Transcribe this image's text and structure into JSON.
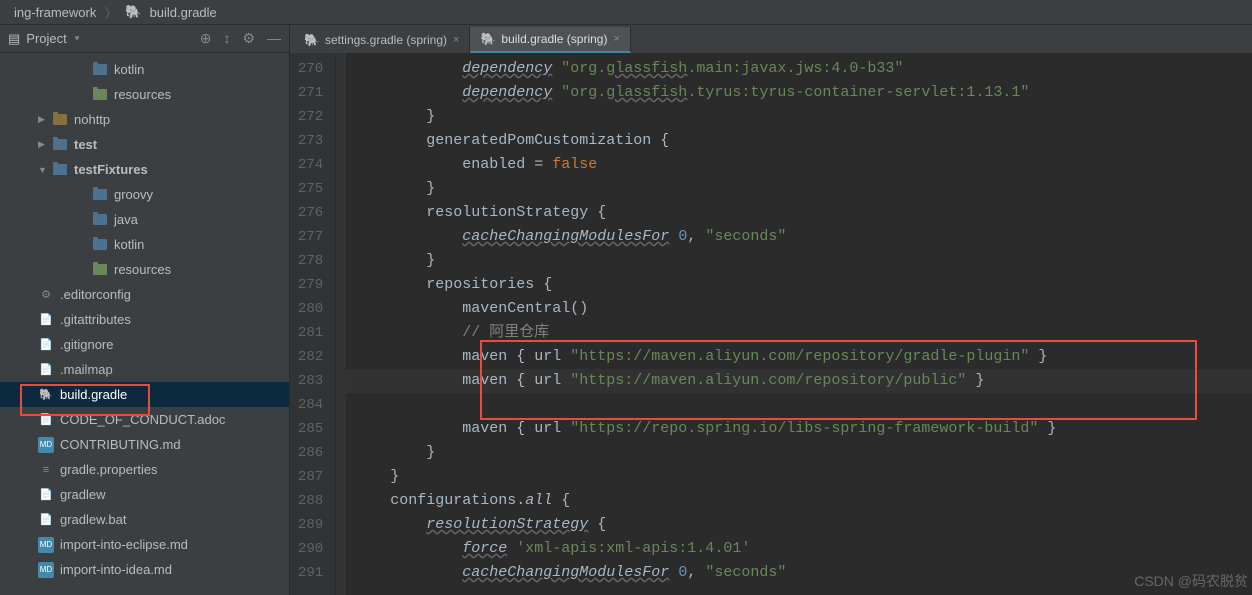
{
  "breadcrumb": {
    "root": "ing-framework",
    "file": "build.gradle"
  },
  "sidebar": {
    "title": "Project",
    "tree": [
      {
        "indent": 70,
        "type": "folder-blue",
        "label": "kotlin"
      },
      {
        "indent": 70,
        "type": "folder-res",
        "label": "resources"
      },
      {
        "indent": 30,
        "arrow": "collapsed",
        "type": "folder",
        "label": "nohttp"
      },
      {
        "indent": 30,
        "arrow": "collapsed",
        "type": "folder-blue",
        "label": "test",
        "bold": true
      },
      {
        "indent": 30,
        "arrow": "expanded",
        "type": "folder-blue",
        "label": "testFixtures",
        "bold": true
      },
      {
        "indent": 70,
        "type": "folder-blue",
        "label": "groovy"
      },
      {
        "indent": 70,
        "type": "folder-blue",
        "label": "java"
      },
      {
        "indent": 70,
        "type": "folder-blue",
        "label": "kotlin"
      },
      {
        "indent": 70,
        "type": "folder-res",
        "label": "resources"
      },
      {
        "indent": 16,
        "type": "gear",
        "label": ".editorconfig"
      },
      {
        "indent": 16,
        "type": "file",
        "label": ".gitattributes"
      },
      {
        "indent": 16,
        "type": "file",
        "label": ".gitignore"
      },
      {
        "indent": 16,
        "type": "file",
        "label": ".mailmap"
      },
      {
        "indent": 16,
        "type": "elephant",
        "label": "build.gradle",
        "selected": true
      },
      {
        "indent": 16,
        "type": "file",
        "label": "CODE_OF_CONDUCT.adoc"
      },
      {
        "indent": 16,
        "type": "md",
        "label": "CONTRIBUTING.md"
      },
      {
        "indent": 16,
        "type": "prop",
        "label": "gradle.properties"
      },
      {
        "indent": 16,
        "type": "file",
        "label": "gradlew"
      },
      {
        "indent": 16,
        "type": "file",
        "label": "gradlew.bat"
      },
      {
        "indent": 16,
        "type": "md",
        "label": "import-into-eclipse.md"
      },
      {
        "indent": 16,
        "type": "md",
        "label": "import-into-idea.md"
      }
    ]
  },
  "tabs": [
    {
      "label": "settings.gradle (spring)",
      "active": false
    },
    {
      "label": "build.gradle (spring)",
      "active": true
    }
  ],
  "code": {
    "start": 270,
    "lines": [
      [
        {
          "t": "            "
        },
        {
          "t": "dependency",
          "c": "fn warn"
        },
        {
          "t": " "
        },
        {
          "t": "\"org.",
          "c": "str"
        },
        {
          "t": "glassfish",
          "c": "str warn"
        },
        {
          "t": ".main:javax.jws:4.0-b33\"",
          "c": "str"
        }
      ],
      [
        {
          "t": "            "
        },
        {
          "t": "dependency",
          "c": "fn warn"
        },
        {
          "t": " "
        },
        {
          "t": "\"org.",
          "c": "str"
        },
        {
          "t": "glassfish",
          "c": "str warn"
        },
        {
          "t": ".tyrus:tyrus-container-servlet:1.13.1\"",
          "c": "str"
        }
      ],
      [
        {
          "t": "        }"
        }
      ],
      [
        {
          "t": "        generatedPomCustomization "
        },
        {
          "t": "{",
          "c": ""
        }
      ],
      [
        {
          "t": "            enabled = "
        },
        {
          "t": "false",
          "c": "kw"
        }
      ],
      [
        {
          "t": "        }"
        }
      ],
      [
        {
          "t": "        resolutionStrategy "
        },
        {
          "t": "{",
          "c": ""
        }
      ],
      [
        {
          "t": "            "
        },
        {
          "t": "cacheChangingModulesFor",
          "c": "fn warn"
        },
        {
          "t": " "
        },
        {
          "t": "0",
          "c": "num"
        },
        {
          "t": ", "
        },
        {
          "t": "\"seconds\"",
          "c": "str"
        }
      ],
      [
        {
          "t": "        }"
        }
      ],
      [
        {
          "t": "        repositories "
        },
        {
          "t": "{",
          "c": ""
        }
      ],
      [
        {
          "t": "            mavenCentral()"
        }
      ],
      [
        {
          "t": "            "
        },
        {
          "t": "// 阿里仓库",
          "c": "cmt"
        }
      ],
      [
        {
          "t": "            maven "
        },
        {
          "t": "{ ",
          "c": ""
        },
        {
          "t": "url "
        },
        {
          "t": "\"https://maven.aliyun.com/repository/gradle-plugin\"",
          "c": "str"
        },
        {
          "t": " }"
        }
      ],
      [
        {
          "t": "            maven "
        },
        {
          "t": "{ ",
          "c": ""
        },
        {
          "t": "url "
        },
        {
          "t": "\"https://maven.aliyun.com/repository/public\"",
          "c": "str"
        },
        {
          "t": " }"
        }
      ],
      [
        {
          "t": ""
        }
      ],
      [
        {
          "t": "            maven "
        },
        {
          "t": "{ ",
          "c": ""
        },
        {
          "t": "url "
        },
        {
          "t": "\"https://repo.spring.io/libs-spring-framework-build\"",
          "c": "str"
        },
        {
          "t": " }"
        }
      ],
      [
        {
          "t": "        }"
        }
      ],
      [
        {
          "t": "    }"
        }
      ],
      [
        {
          "t": "    configurations."
        },
        {
          "t": "all",
          "c": "fn"
        },
        {
          "t": " "
        },
        {
          "t": "{",
          "c": ""
        }
      ],
      [
        {
          "t": "        "
        },
        {
          "t": "resolutionStrategy",
          "c": "fn warn"
        },
        {
          "t": " "
        },
        {
          "t": "{",
          "c": ""
        }
      ],
      [
        {
          "t": "            "
        },
        {
          "t": "force",
          "c": "fn warn"
        },
        {
          "t": " "
        },
        {
          "t": "'xml-apis:xml-apis:1.4.01'",
          "c": "str"
        }
      ],
      [
        {
          "t": "            "
        },
        {
          "t": "cacheChangingModulesFor",
          "c": "fn warn"
        },
        {
          "t": " "
        },
        {
          "t": "0",
          "c": "num"
        },
        {
          "t": ", "
        },
        {
          "t": "\"seconds\"",
          "c": "str"
        }
      ]
    ],
    "current_line_index": 13
  },
  "watermark": "CSDN @码农脱贫"
}
